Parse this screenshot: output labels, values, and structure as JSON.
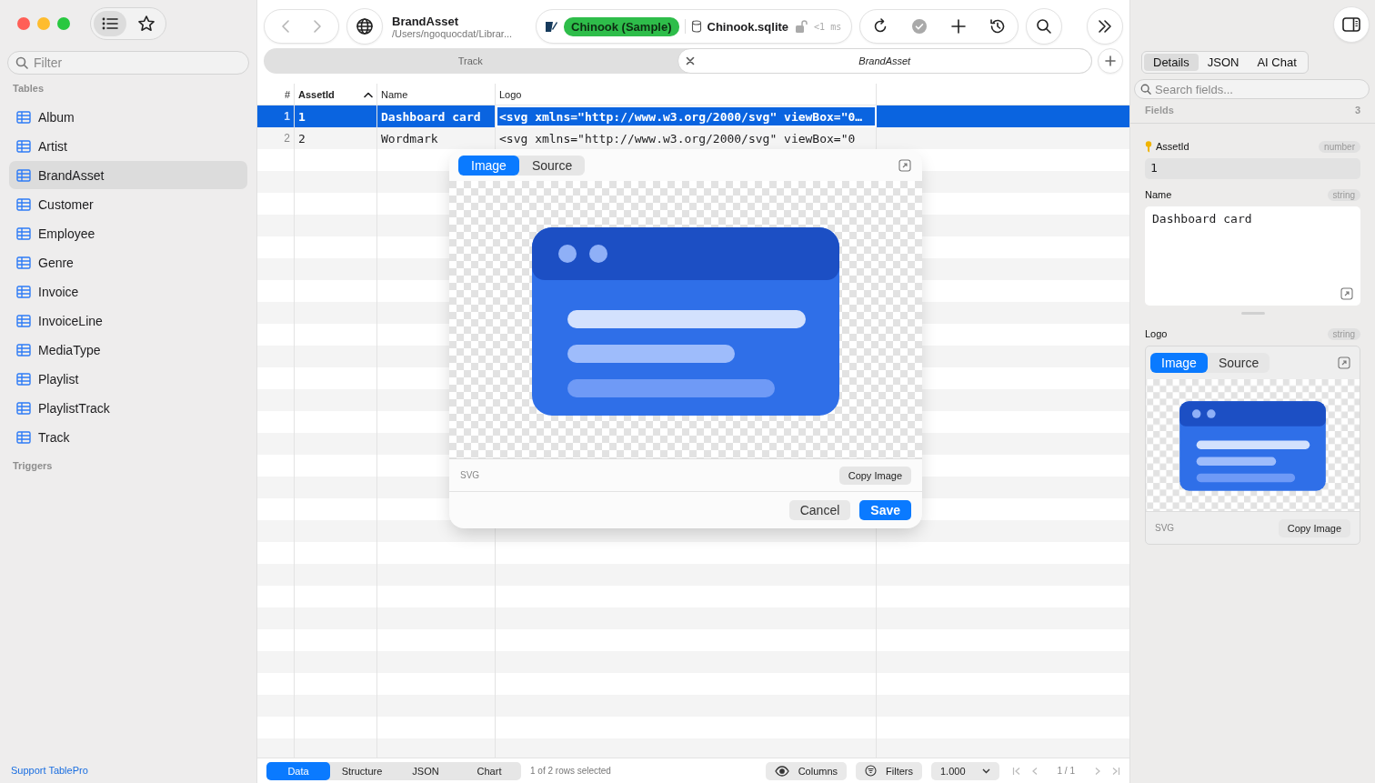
{
  "sidebar": {
    "filter": {
      "placeholder": "Filter"
    },
    "sections": [
      {
        "title": "Tables",
        "items": [
          {
            "label": "Album",
            "selected": false
          },
          {
            "label": "Artist",
            "selected": false
          },
          {
            "label": "BrandAsset",
            "selected": true
          },
          {
            "label": "Customer",
            "selected": false
          },
          {
            "label": "Employee",
            "selected": false
          },
          {
            "label": "Genre",
            "selected": false
          },
          {
            "label": "Invoice",
            "selected": false
          },
          {
            "label": "InvoiceLine",
            "selected": false
          },
          {
            "label": "MediaType",
            "selected": false
          },
          {
            "label": "Playlist",
            "selected": false
          },
          {
            "label": "PlaylistTrack",
            "selected": false
          },
          {
            "label": "Track",
            "selected": false
          }
        ]
      },
      {
        "title": "Triggers"
      }
    ],
    "footer_link": "Support TablePro"
  },
  "toolbar": {
    "title": "BrandAsset",
    "path": "/Users/ngoquocdat/Librar...",
    "connection": "Chinook (Sample)",
    "database": "Chinook.sqlite",
    "timing": "<1 ms"
  },
  "tabs": [
    {
      "label": "Track",
      "selected": false
    },
    {
      "label": "BrandAsset",
      "selected": true
    }
  ],
  "table": {
    "columns": [
      {
        "label": "#"
      },
      {
        "label": "AssetId",
        "sort_ascending": true
      },
      {
        "label": "Name"
      },
      {
        "label": "Logo"
      }
    ],
    "rows": [
      {
        "selected": true,
        "cells": [
          "1",
          "1",
          "Dashboard card",
          "<svg xmlns=\"http://www.w3.org/2000/svg\" viewBox=\"0…"
        ]
      },
      {
        "selected": false,
        "cells": [
          "2",
          "2",
          "Wordmark",
          "<svg xmlns=\"http://www.w3.org/2000/svg\" viewBox=\"0"
        ]
      }
    ]
  },
  "popover": {
    "tabs": [
      {
        "label": "Image",
        "selected": true
      },
      {
        "label": "Source",
        "selected": false
      }
    ],
    "preview": {
      "kind": "picture"
    },
    "format": "SVG",
    "copy_button": "Copy Image",
    "buttons": [
      {
        "label": "Cancel",
        "kind": "secondary"
      },
      {
        "label": "Save",
        "kind": "primary"
      }
    ]
  },
  "bottom_bar": {
    "views": [
      {
        "label": "Data",
        "selected": true
      },
      {
        "label": "Structure",
        "selected": false
      },
      {
        "label": "JSON",
        "selected": false
      },
      {
        "label": "Chart",
        "selected": false
      }
    ],
    "status": "1 of 2 rows selected",
    "columns_button": "Columns",
    "filters_button": "Filters",
    "limit": "1.000",
    "page": "1 / 1"
  },
  "inspector": {
    "tabs": [
      {
        "label": "Details",
        "selected": true
      },
      {
        "label": "JSON",
        "selected": false
      },
      {
        "label": "AI Chat",
        "selected": false
      }
    ],
    "search": {
      "placeholder": "Search fields..."
    },
    "fields_label": "Fields",
    "fields_count": "3",
    "fields": [
      {
        "kind": "text",
        "name": "AssetId",
        "type": "number",
        "primary_key": true,
        "value": "1"
      },
      {
        "kind": "textarea",
        "name": "Name",
        "type": "string",
        "primary_key": false,
        "value": "Dashboard card"
      },
      {
        "name": "Logo",
        "type": "string",
        "primary_key": false,
        "tabs": [
          {
            "label": "Image",
            "selected": true
          },
          {
            "label": "Source",
            "selected": false
          }
        ],
        "preview": {
          "kind": "picture"
        },
        "format": "SVG",
        "copy_button": "Copy Image"
      }
    ]
  }
}
